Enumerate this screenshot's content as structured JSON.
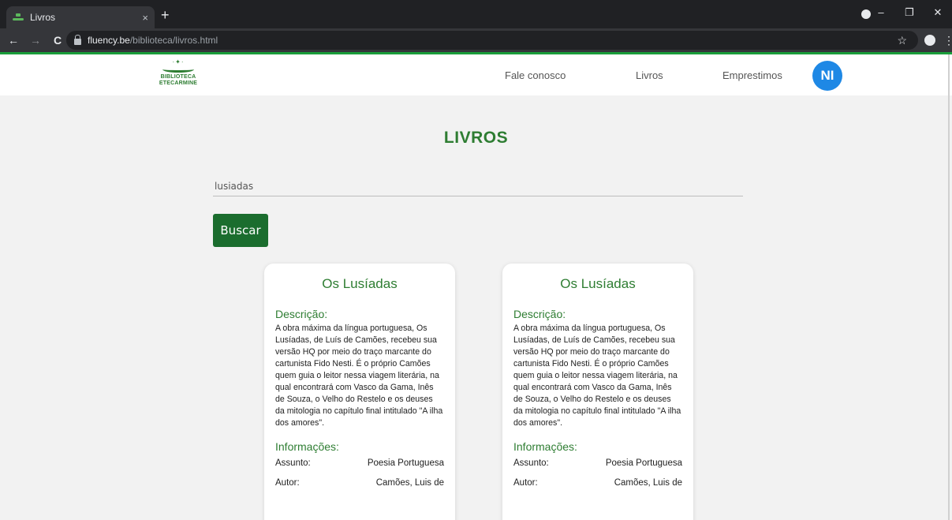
{
  "browser": {
    "tab_title": "Livros",
    "tab_close": "×",
    "new_tab": "+",
    "url_host": "fluency.be",
    "url_path": "/biblioteca/livros.html",
    "back_icon": "←",
    "forward_icon": "→",
    "reload_icon": "C",
    "star_icon": "☆",
    "menu_icon": "⋮",
    "minimize": "–",
    "maximize": "❐",
    "close": "✕"
  },
  "header": {
    "logo_line1": "BIBLIOTECA",
    "logo_line2": "ETECARMINE",
    "nav": [
      "Fale conosco",
      "Livros",
      "Emprestimos"
    ],
    "avatar": "NI"
  },
  "main": {
    "title": "LIVROS",
    "search_value": "lusiadas",
    "search_button": "Buscar"
  },
  "cards": [
    {
      "title": "Os Lusíadas",
      "desc_label": "Descrição:",
      "description": "A obra máxima da língua portuguesa, Os Lusíadas, de Luís de Camões, recebeu sua versão HQ por meio do traço marcante do cartunista Fido Nesti. É o próprio Camões quem guia o leitor nessa viagem literária, na qual encontrará com Vasco da Gama, Inês de Souza, o Velho do Restelo e os deuses da mitologia no capítulo final intitulado \"A ilha dos amores\".",
      "info_label": "Informações:",
      "info": [
        {
          "key": "Assunto:",
          "value": "Poesia Portuguesa"
        },
        {
          "key": "Autor:",
          "value": "Camões, Luis de"
        }
      ]
    },
    {
      "title": "Os Lusíadas",
      "desc_label": "Descrição:",
      "description": "A obra máxima da língua portuguesa, Os Lusíadas, de Luís de Camões, recebeu sua versão HQ por meio do traço marcante do cartunista Fido Nesti. É o próprio Camões quem guia o leitor nessa viagem literária, na qual encontrará com Vasco da Gama, Inês de Souza, o Velho do Restelo e os deuses da mitologia no capítulo final intitulado \"A ilha dos amores\".",
      "info_label": "Informações:",
      "info": [
        {
          "key": "Assunto:",
          "value": "Poesia Portuguesa"
        },
        {
          "key": "Autor:",
          "value": "Camões, Luis de"
        }
      ]
    }
  ],
  "colors": {
    "accent_green": "#2e7d32",
    "button_green": "#1b6d2e",
    "avatar_blue": "#1e88e5"
  }
}
